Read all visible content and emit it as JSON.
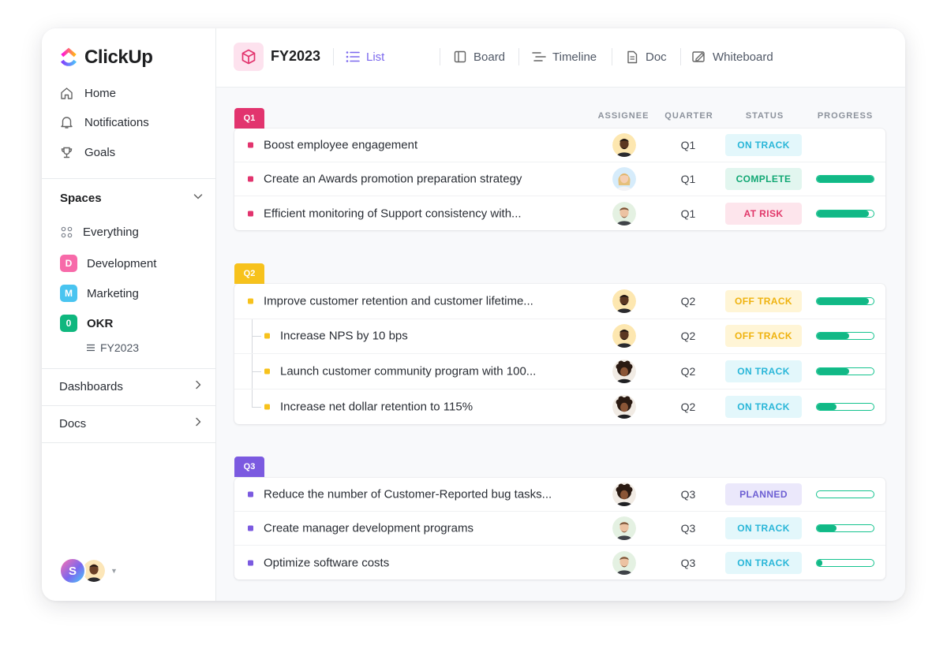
{
  "app": {
    "name": "ClickUp"
  },
  "sidebar": {
    "nav": [
      {
        "label": "Home",
        "icon": "home-icon"
      },
      {
        "label": "Notifications",
        "icon": "bell-icon"
      },
      {
        "label": "Goals",
        "icon": "trophy-icon"
      }
    ],
    "spaces_label": "Spaces",
    "everything_label": "Everything",
    "spaces": [
      {
        "letter": "D",
        "label": "Development",
        "color": "#f76aa9"
      },
      {
        "letter": "M",
        "label": "Marketing",
        "color": "#49c4f0"
      },
      {
        "letter": "0",
        "label": "OKR",
        "color": "#0fb77e"
      }
    ],
    "list_item": "FY2023",
    "dashboards_label": "Dashboards",
    "docs_label": "Docs",
    "user_initial": "S"
  },
  "header": {
    "project_title": "FY2023",
    "tabs": [
      {
        "label": "List",
        "icon": "list-icon",
        "active": true
      },
      {
        "label": "Board",
        "icon": "board-icon",
        "active": false
      },
      {
        "label": "Timeline",
        "icon": "timeline-icon",
        "active": false
      },
      {
        "label": "Doc",
        "icon": "doc-icon",
        "active": false
      },
      {
        "label": "Whiteboard",
        "icon": "whiteboard-icon",
        "active": false
      }
    ]
  },
  "columns": {
    "assignee": "ASSIGNEE",
    "quarter": "QUARTER",
    "status": "STATUS",
    "progress": "PROGRESS"
  },
  "status_colors": {
    "ON TRACK": {
      "bg": "#e3f7fb",
      "fg": "#29b6d8"
    },
    "COMPLETE": {
      "bg": "#e2f6ef",
      "fg": "#12a874"
    },
    "AT RISK": {
      "bg": "#fde5ec",
      "fg": "#e1386a"
    },
    "OFF TRACK": {
      "bg": "#fff5d6",
      "fg": "#efb20e"
    },
    "PLANNED": {
      "bg": "#ebe8fb",
      "fg": "#6d5fd3"
    }
  },
  "groups": [
    {
      "tag": "Q1",
      "color": "#e2346e",
      "rows": [
        {
          "name": "Boost employee engagement",
          "quarter": "Q1",
          "status": "ON TRACK",
          "progress": null,
          "avatar": "avatar-man-dark"
        },
        {
          "name": "Create an Awards promotion preparation strategy",
          "quarter": "Q1",
          "status": "COMPLETE",
          "progress": 100,
          "avatar": "avatar-woman-blonde"
        },
        {
          "name": "Efficient monitoring of Support consistency with...",
          "quarter": "Q1",
          "status": "AT RISK",
          "progress": 92,
          "avatar": "avatar-man-light"
        }
      ]
    },
    {
      "tag": "Q2",
      "color": "#f7c21c",
      "rows": [
        {
          "name": "Improve customer retention and customer lifetime...",
          "quarter": "Q2",
          "status": "OFF TRACK",
          "progress": 92,
          "avatar": "avatar-man-dark",
          "sub": false
        },
        {
          "name": "Increase NPS by 10 bps",
          "quarter": "Q2",
          "status": "OFF TRACK",
          "progress": 57,
          "avatar": "avatar-man-dark",
          "sub": true
        },
        {
          "name": "Launch customer community program with 100...",
          "quarter": "Q2",
          "status": "ON TRACK",
          "progress": 57,
          "avatar": "avatar-curly",
          "sub": true
        },
        {
          "name": "Increase net dollar retention to 115%",
          "quarter": "Q2",
          "status": "ON TRACK",
          "progress": 35,
          "avatar": "avatar-curly",
          "sub": true
        }
      ]
    },
    {
      "tag": "Q3",
      "color": "#7b5ae0",
      "rows": [
        {
          "name": "Reduce the number of Customer-Reported bug tasks...",
          "quarter": "Q3",
          "status": "PLANNED",
          "progress": 0,
          "avatar": "avatar-curly"
        },
        {
          "name": "Create manager development programs",
          "quarter": "Q3",
          "status": "ON TRACK",
          "progress": 35,
          "avatar": "avatar-man-light"
        },
        {
          "name": "Optimize software costs",
          "quarter": "Q3",
          "status": "ON TRACK",
          "progress": 10,
          "avatar": "avatar-man-light"
        }
      ]
    }
  ]
}
